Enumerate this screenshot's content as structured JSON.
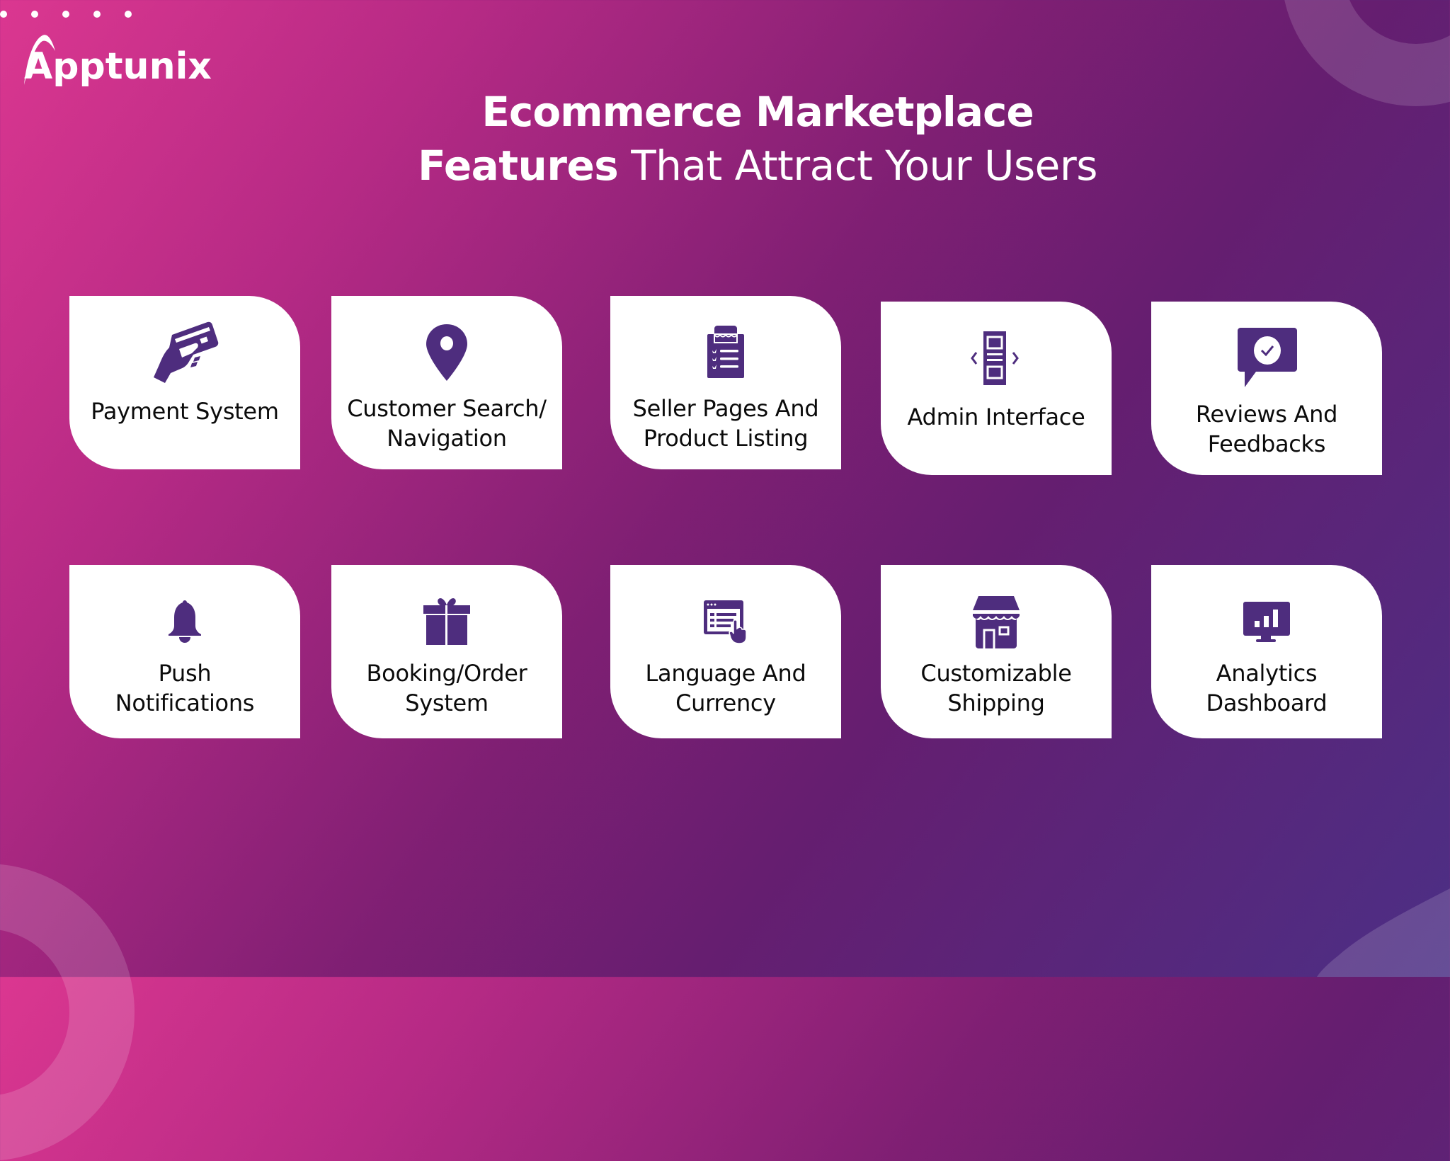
{
  "brand": {
    "name": "Apptunix"
  },
  "title": {
    "line1": "Ecommerce Marketplace",
    "line2_bold": "Features",
    "line2_light": " That Attract Your Users"
  },
  "colors": {
    "gradient_start": "#db3790",
    "gradient_mid": "#651e70",
    "gradient_end": "#4c2f85",
    "icon": "#4e2d7e",
    "card_bg": "#ffffff",
    "label_text": "#0b0b0b"
  },
  "features": [
    {
      "label": "Payment System",
      "icon": "card-in-hand-icon"
    },
    {
      "label": "Customer Search/\nNavigation",
      "icon": "location-pin-icon"
    },
    {
      "label": "Seller Pages And\nProduct Listing",
      "icon": "store-checklist-icon"
    },
    {
      "label": "Admin Interface",
      "icon": "admin-layout-icon"
    },
    {
      "label": "Reviews And\nFeedbacks",
      "icon": "review-chat-check-icon"
    },
    {
      "label": "Push\nNotifications",
      "icon": "bell-icon"
    },
    {
      "label": "Booking/Order\nSystem",
      "icon": "gift-box-icon"
    },
    {
      "label": "Language And\nCurrency",
      "icon": "browser-click-icon"
    },
    {
      "label": "Customizable\nShipping",
      "icon": "storefront-icon"
    },
    {
      "label": "Analytics\nDashboard",
      "icon": "analytics-monitor-icon"
    }
  ]
}
